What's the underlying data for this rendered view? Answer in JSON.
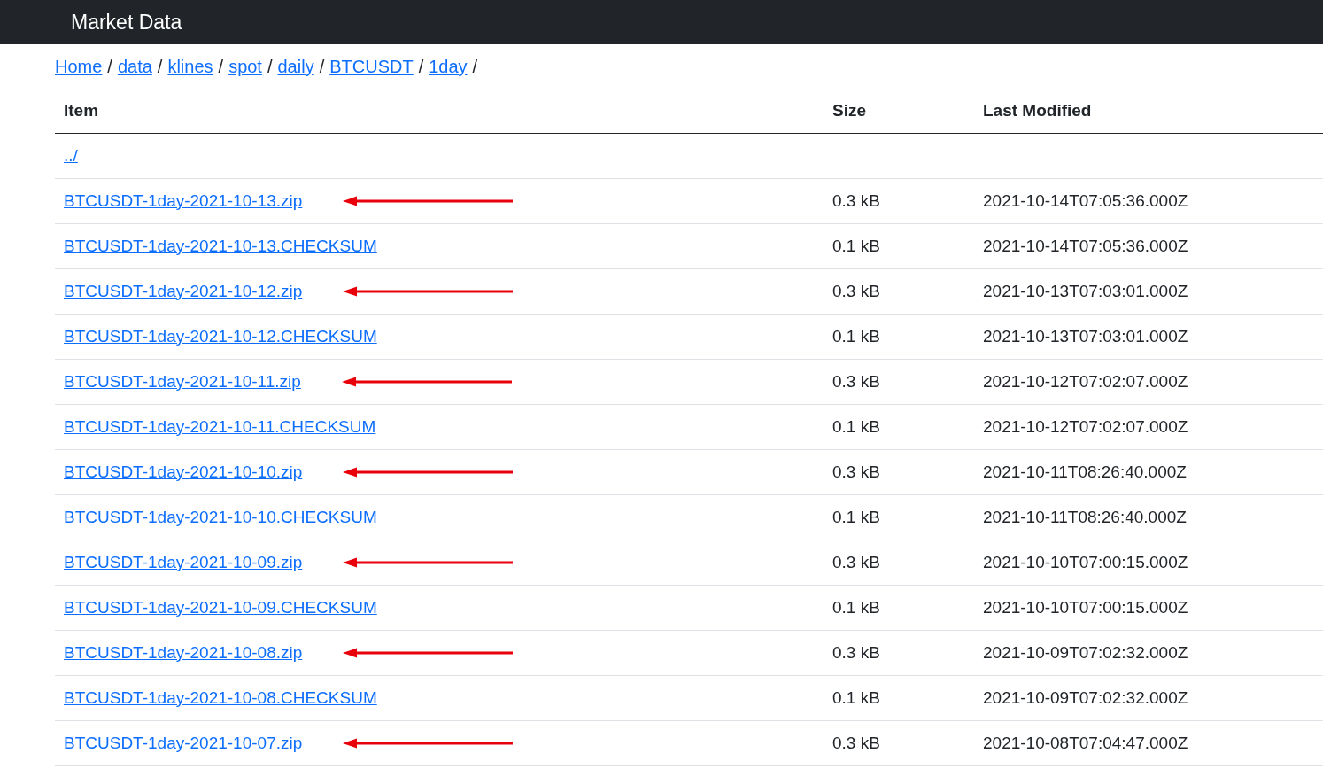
{
  "header": {
    "title": "Market Data"
  },
  "breadcrumb": [
    "Home",
    "data",
    "klines",
    "spot",
    "daily",
    "BTCUSDT",
    "1day"
  ],
  "breadcrumb_separator": "/",
  "table": {
    "columns": [
      "Item",
      "Size",
      "Last Modified"
    ],
    "rows": [
      {
        "item": "../",
        "size": "",
        "modified": "",
        "marked": false
      },
      {
        "item": "BTCUSDT-1day-2021-10-13.zip",
        "size": "0.3 kB",
        "modified": "2021-10-14T07:05:36.000Z",
        "marked": true
      },
      {
        "item": "BTCUSDT-1day-2021-10-13.CHECKSUM",
        "size": "0.1 kB",
        "modified": "2021-10-14T07:05:36.000Z",
        "marked": false
      },
      {
        "item": "BTCUSDT-1day-2021-10-12.zip",
        "size": "0.3 kB",
        "modified": "2021-10-13T07:03:01.000Z",
        "marked": true
      },
      {
        "item": "BTCUSDT-1day-2021-10-12.CHECKSUM",
        "size": "0.1 kB",
        "modified": "2021-10-13T07:03:01.000Z",
        "marked": false
      },
      {
        "item": "BTCUSDT-1day-2021-10-11.zip",
        "size": "0.3 kB",
        "modified": "2021-10-12T07:02:07.000Z",
        "marked": true
      },
      {
        "item": "BTCUSDT-1day-2021-10-11.CHECKSUM",
        "size": "0.1 kB",
        "modified": "2021-10-12T07:02:07.000Z",
        "marked": false
      },
      {
        "item": "BTCUSDT-1day-2021-10-10.zip",
        "size": "0.3 kB",
        "modified": "2021-10-11T08:26:40.000Z",
        "marked": true
      },
      {
        "item": "BTCUSDT-1day-2021-10-10.CHECKSUM",
        "size": "0.1 kB",
        "modified": "2021-10-11T08:26:40.000Z",
        "marked": false
      },
      {
        "item": "BTCUSDT-1day-2021-10-09.zip",
        "size": "0.3 kB",
        "modified": "2021-10-10T07:00:15.000Z",
        "marked": true
      },
      {
        "item": "BTCUSDT-1day-2021-10-09.CHECKSUM",
        "size": "0.1 kB",
        "modified": "2021-10-10T07:00:15.000Z",
        "marked": false
      },
      {
        "item": "BTCUSDT-1day-2021-10-08.zip",
        "size": "0.3 kB",
        "modified": "2021-10-09T07:02:32.000Z",
        "marked": true
      },
      {
        "item": "BTCUSDT-1day-2021-10-08.CHECKSUM",
        "size": "0.1 kB",
        "modified": "2021-10-09T07:02:32.000Z",
        "marked": false
      },
      {
        "item": "BTCUSDT-1day-2021-10-07.zip",
        "size": "0.3 kB",
        "modified": "2021-10-08T07:04:47.000Z",
        "marked": true
      }
    ]
  }
}
